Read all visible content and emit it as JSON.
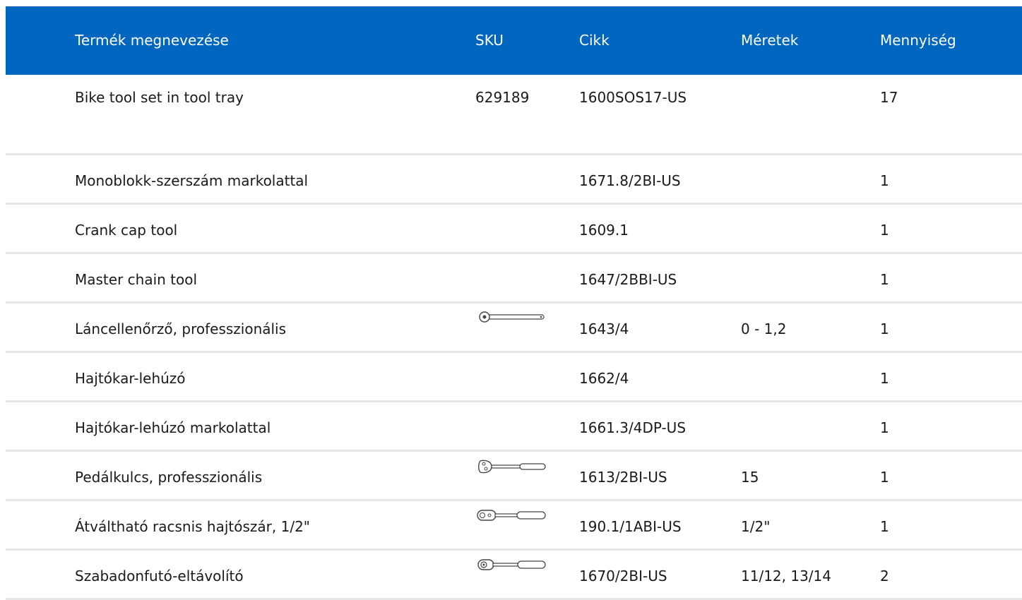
{
  "columns": [
    "Termék megnevezése",
    "SKU",
    "Cikk",
    "Méretek",
    "Mennyiség"
  ],
  "rows": [
    {
      "name": "Bike tool set in tool tray",
      "sku": "629189",
      "cikk": "1600SOS17-US",
      "meretek": "",
      "qty": "17",
      "icon": ""
    },
    {
      "name": "Monoblokk-szerszám markolattal",
      "sku": "",
      "cikk": "1671.8/2BI-US",
      "meretek": "",
      "qty": "1",
      "icon": ""
    },
    {
      "name": "Crank cap tool",
      "sku": "",
      "cikk": "1609.1",
      "meretek": "",
      "qty": "1",
      "icon": ""
    },
    {
      "name": "Master chain tool",
      "sku": "",
      "cikk": "1647/2BBI-US",
      "meretek": "",
      "qty": "1",
      "icon": ""
    },
    {
      "name": "Láncellenőrző, professzionális",
      "sku": "",
      "cikk": "1643/4",
      "meretek": "0 - 1,2",
      "qty": "1",
      "icon": "chain-checker-icon"
    },
    {
      "name": "Hajtókar-lehúzó",
      "sku": "",
      "cikk": "1662/4",
      "meretek": "",
      "qty": "1",
      "icon": ""
    },
    {
      "name": "Hajtókar-lehúzó markolattal",
      "sku": "",
      "cikk": "1661.3/4DP-US",
      "meretek": "",
      "qty": "1",
      "icon": ""
    },
    {
      "name": "Pedálkulcs, professzionális",
      "sku": "",
      "cikk": "1613/2BI-US",
      "meretek": "15",
      "qty": "1",
      "icon": "pedal-wrench-icon"
    },
    {
      "name": "Átváltható racsnis hajtószár, 1/2\"",
      "sku": "",
      "cikk": "190.1/1ABI-US",
      "meretek": "1/2\"",
      "qty": "1",
      "icon": "ratchet-icon"
    },
    {
      "name": "Szabadonfutó-eltávolító",
      "sku": "",
      "cikk": "1670/2BI-US",
      "meretek": "11/12, 13/14",
      "qty": "2",
      "icon": "freewheel-remover-icon"
    }
  ],
  "colors": {
    "header_bg": "#0066bf",
    "header_text": "#ffffff",
    "row_divider": "#e6e6e6"
  }
}
